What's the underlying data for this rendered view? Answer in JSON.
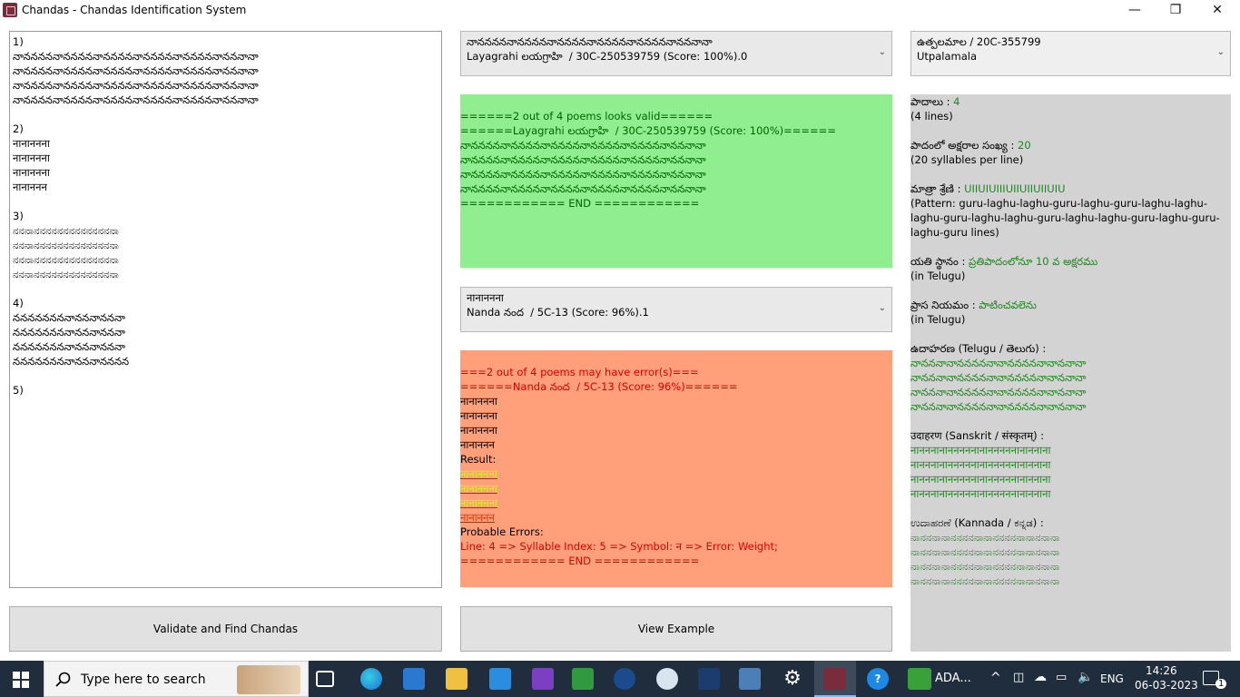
{
  "window": {
    "title": "Chandas - Chandas Identification System",
    "minimize": "—",
    "maximize": "❐",
    "close": "✕"
  },
  "input": {
    "lines": [
      "1)",
      "నానననననానననననానననననానననననానననననానననానా",
      "నానననననానననననానననననానననననానననననానననానా",
      "నానననననానననననానననననానననననానననననానననానా",
      "నానననననానననననానననననానననననానననననానననానా",
      "",
      "2)",
      "नानाननना",
      "नानाननना",
      "नानाननना",
      "नानाननन",
      "",
      "3)",
      "ನನನಾನನನನನನನನನನನನನನಾ",
      "ನನನಾನನನನನನನನನನನನನನಾ",
      "ನನನಾನನನನನನನನನನನನನನಾ",
      "ನನನಾನನನನನನನನನನನನನನಾ",
      "",
      "4)",
      "ననననననననానననానననా",
      "ననననననననానననానననా",
      "ననననననననానననానననా",
      "ననననననననానననానననన",
      "",
      "5)"
    ]
  },
  "combo1": {
    "line1": "నానననననానననననానననననానననననానననననానననానా",
    "line2": "Layagrahi లయగ్రాహి  / 30C-250539759 (Score: 100%).0"
  },
  "combo2": {
    "line1": "नानाननना",
    "line2": "Nanda నంద  / 5C-13 (Score: 96%).1"
  },
  "combo3": {
    "line1": "ఉత్పలమాల / 20C-355799",
    "line2": "Utpalamala"
  },
  "valid_panel": {
    "lines": [
      "======2 out of 4 poems looks valid======",
      "======Layagrahi లయగ్రాహి  / 30C-250539759 (Score: 100%)======",
      "నానననననానననననానననననానననననానననననానననానా",
      "నానననననానననననానననననానననననానననననానననానా",
      "నానననననానననననానననననానననననానననననానననానా",
      "నానననననానననననానననననానననననానననననానననానా",
      "============ END ============"
    ]
  },
  "error_panel": {
    "header1": "===2 out of 4 poems may have error(s)===",
    "header2": "======Nanda నంద  / 5C-13 (Score: 96%)======",
    "poem_lines": [
      "नानाननना",
      "नानाननना",
      "नानाननना",
      "नानाननन"
    ],
    "result_label": "Result:",
    "result_lines": [
      "नानाननना",
      "नानाननना",
      "नानाननना"
    ],
    "result_error_line": "नानाननन",
    "probable_label": "Probable Errors:",
    "error_detail": "Line: 4 => Syllable Index: 5 => Symbol: न => Error: Weight;",
    "end": "============ END ============"
  },
  "info": {
    "padalu_label": "పాదాలు : ",
    "padalu_value": "4",
    "padalu_note": "(4 lines)",
    "akshara_label": "పాదంలో అక్షరాల సంఖ్య : ",
    "akshara_value": "20",
    "akshara_note": "(20 syllables per line)",
    "matra_label": "మాత్రా శ్రేణి : ",
    "matra_value": "UIIUIUIIIUIIUIIUIIUIU",
    "matra_note": "(Pattern: guru-laghu-laghu-guru-laghu-guru-laghu-laghu-laghu-guru-laghu-laghu-guru-laghu-laghu-guru-laghu-guru-laghu-guru lines)",
    "yati_label": "యతి స్థానం : ",
    "yati_value": "ప్రతిపాదంలోనూ 10 వ అక్షరము",
    "yati_note": "(in Telugu)",
    "prasa_label": "ప్రాస నియమం : ",
    "prasa_value": "పాటించవలెను",
    "prasa_note": "(in Telugu)",
    "ex_te_label": "ఉదాహరణ (Telugu / తెలుగు) :",
    "ex_te_lines": [
      "నానననానానననననానానననననానాననానా",
      "నానననానానననననానానననననానాననానా",
      "నానననానానననననానానననననానాననానా",
      "నానననానానననననానానననననానాననానా"
    ],
    "ex_sa_label": "उदाहरण (Sanskrit / संस्कृतम्) :",
    "ex_sa_lines": [
      "नानननानानननननानानननननानाननाना",
      "नानननानानननननानानननननानाननाना",
      "नानननानानननननानानननननानाननाना",
      "नानननानानननननानानननननानाननाना"
    ],
    "ex_kn_label": "ಉದಾಹರಣೆ (Kannada / ಕನ್ನಡ) :",
    "ex_kn_lines": [
      "ನಾನನನಾನಾನನನನನಾನಾನನನನನಾನಾನನಾನಾ",
      "ನಾನನನಾನಾನನನನನಾನಾನನನನನಾನಾನನಾನಾ",
      "ನಾನನನಾನಾನನನನನಾನಾನನನನನಾನಾನನಾನಾ",
      "ನಾನನನಾನಾನನನನನಾನಾನನನನನಾನಾನನಾನಾ"
    ]
  },
  "buttons": {
    "validate": "Validate and Find Chandas",
    "view_example": "View Example"
  },
  "taskbar": {
    "search_placeholder": "Type here to search",
    "ada_label": "ADA...",
    "language": "ENG",
    "time": "14:26",
    "date": "06-03-2023",
    "notification_count": "1"
  }
}
